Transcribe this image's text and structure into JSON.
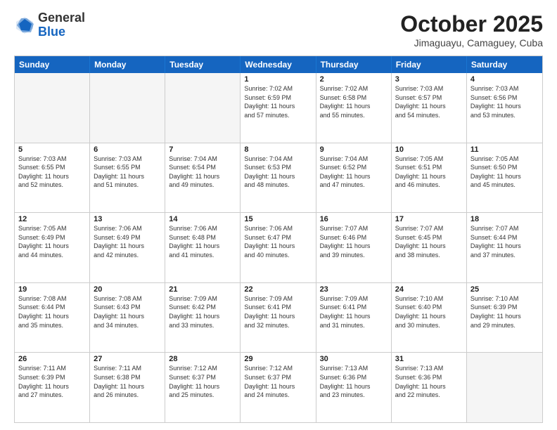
{
  "logo": {
    "general": "General",
    "blue": "Blue"
  },
  "header": {
    "month_year": "October 2025",
    "location": "Jimaguayu, Camaguey, Cuba"
  },
  "weekdays": [
    "Sunday",
    "Monday",
    "Tuesday",
    "Wednesday",
    "Thursday",
    "Friday",
    "Saturday"
  ],
  "rows": [
    [
      {
        "day": "",
        "info": "",
        "empty": true
      },
      {
        "day": "",
        "info": "",
        "empty": true
      },
      {
        "day": "",
        "info": "",
        "empty": true
      },
      {
        "day": "1",
        "info": "Sunrise: 7:02 AM\nSunset: 6:59 PM\nDaylight: 11 hours\nand 57 minutes."
      },
      {
        "day": "2",
        "info": "Sunrise: 7:02 AM\nSunset: 6:58 PM\nDaylight: 11 hours\nand 55 minutes."
      },
      {
        "day": "3",
        "info": "Sunrise: 7:03 AM\nSunset: 6:57 PM\nDaylight: 11 hours\nand 54 minutes."
      },
      {
        "day": "4",
        "info": "Sunrise: 7:03 AM\nSunset: 6:56 PM\nDaylight: 11 hours\nand 53 minutes."
      }
    ],
    [
      {
        "day": "5",
        "info": "Sunrise: 7:03 AM\nSunset: 6:55 PM\nDaylight: 11 hours\nand 52 minutes."
      },
      {
        "day": "6",
        "info": "Sunrise: 7:03 AM\nSunset: 6:55 PM\nDaylight: 11 hours\nand 51 minutes."
      },
      {
        "day": "7",
        "info": "Sunrise: 7:04 AM\nSunset: 6:54 PM\nDaylight: 11 hours\nand 49 minutes."
      },
      {
        "day": "8",
        "info": "Sunrise: 7:04 AM\nSunset: 6:53 PM\nDaylight: 11 hours\nand 48 minutes."
      },
      {
        "day": "9",
        "info": "Sunrise: 7:04 AM\nSunset: 6:52 PM\nDaylight: 11 hours\nand 47 minutes."
      },
      {
        "day": "10",
        "info": "Sunrise: 7:05 AM\nSunset: 6:51 PM\nDaylight: 11 hours\nand 46 minutes."
      },
      {
        "day": "11",
        "info": "Sunrise: 7:05 AM\nSunset: 6:50 PM\nDaylight: 11 hours\nand 45 minutes."
      }
    ],
    [
      {
        "day": "12",
        "info": "Sunrise: 7:05 AM\nSunset: 6:49 PM\nDaylight: 11 hours\nand 44 minutes."
      },
      {
        "day": "13",
        "info": "Sunrise: 7:06 AM\nSunset: 6:49 PM\nDaylight: 11 hours\nand 42 minutes."
      },
      {
        "day": "14",
        "info": "Sunrise: 7:06 AM\nSunset: 6:48 PM\nDaylight: 11 hours\nand 41 minutes."
      },
      {
        "day": "15",
        "info": "Sunrise: 7:06 AM\nSunset: 6:47 PM\nDaylight: 11 hours\nand 40 minutes."
      },
      {
        "day": "16",
        "info": "Sunrise: 7:07 AM\nSunset: 6:46 PM\nDaylight: 11 hours\nand 39 minutes."
      },
      {
        "day": "17",
        "info": "Sunrise: 7:07 AM\nSunset: 6:45 PM\nDaylight: 11 hours\nand 38 minutes."
      },
      {
        "day": "18",
        "info": "Sunrise: 7:07 AM\nSunset: 6:44 PM\nDaylight: 11 hours\nand 37 minutes."
      }
    ],
    [
      {
        "day": "19",
        "info": "Sunrise: 7:08 AM\nSunset: 6:44 PM\nDaylight: 11 hours\nand 35 minutes."
      },
      {
        "day": "20",
        "info": "Sunrise: 7:08 AM\nSunset: 6:43 PM\nDaylight: 11 hours\nand 34 minutes."
      },
      {
        "day": "21",
        "info": "Sunrise: 7:09 AM\nSunset: 6:42 PM\nDaylight: 11 hours\nand 33 minutes."
      },
      {
        "day": "22",
        "info": "Sunrise: 7:09 AM\nSunset: 6:41 PM\nDaylight: 11 hours\nand 32 minutes."
      },
      {
        "day": "23",
        "info": "Sunrise: 7:09 AM\nSunset: 6:41 PM\nDaylight: 11 hours\nand 31 minutes."
      },
      {
        "day": "24",
        "info": "Sunrise: 7:10 AM\nSunset: 6:40 PM\nDaylight: 11 hours\nand 30 minutes."
      },
      {
        "day": "25",
        "info": "Sunrise: 7:10 AM\nSunset: 6:39 PM\nDaylight: 11 hours\nand 29 minutes."
      }
    ],
    [
      {
        "day": "26",
        "info": "Sunrise: 7:11 AM\nSunset: 6:39 PM\nDaylight: 11 hours\nand 27 minutes."
      },
      {
        "day": "27",
        "info": "Sunrise: 7:11 AM\nSunset: 6:38 PM\nDaylight: 11 hours\nand 26 minutes."
      },
      {
        "day": "28",
        "info": "Sunrise: 7:12 AM\nSunset: 6:37 PM\nDaylight: 11 hours\nand 25 minutes."
      },
      {
        "day": "29",
        "info": "Sunrise: 7:12 AM\nSunset: 6:37 PM\nDaylight: 11 hours\nand 24 minutes."
      },
      {
        "day": "30",
        "info": "Sunrise: 7:13 AM\nSunset: 6:36 PM\nDaylight: 11 hours\nand 23 minutes."
      },
      {
        "day": "31",
        "info": "Sunrise: 7:13 AM\nSunset: 6:36 PM\nDaylight: 11 hours\nand 22 minutes."
      },
      {
        "day": "",
        "info": "",
        "empty": true
      }
    ]
  ]
}
